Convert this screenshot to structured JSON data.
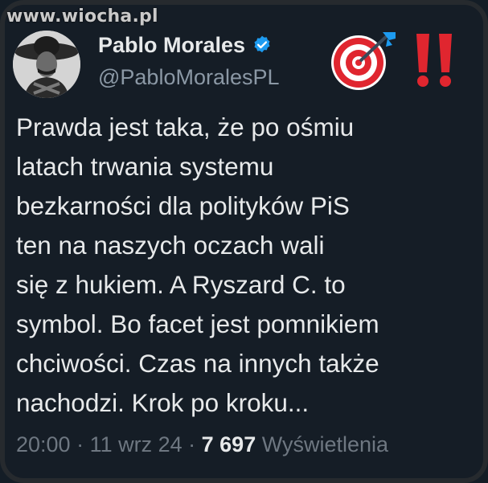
{
  "watermark": "www.wiocha.pl",
  "author": {
    "display_name": "Pablo Morales",
    "handle": "@PabloMoralesPL",
    "verified_icon": "verified-badge-icon",
    "avatar": "avatar-photo"
  },
  "emojis": [
    "direct-hit-target-icon",
    "double-exclamation-icon"
  ],
  "tweet": {
    "text": "Prawda jest taka, że po ośmiu\nlatach trwania systemu\nbezkarności dla polityków PiS\nten na naszych oczach wali\nsię z hukiem. A Ryszard C. to\nsymbol. Bo facet jest pomnikiem\nchciwości. Czas na innych także\nnachodzi. Krok po kroku..."
  },
  "meta": {
    "time": "20:00",
    "sep1": " · ",
    "date": "11 wrz 24",
    "sep2": " · ",
    "views_count": "7 697",
    "views_label": " Wyświetlenia"
  },
  "colors": {
    "background": "#151d26",
    "text": "#e7e9ea",
    "secondary": "#8b98a5",
    "verified": "#1d9bf0",
    "alert_red": "#e0262f"
  }
}
